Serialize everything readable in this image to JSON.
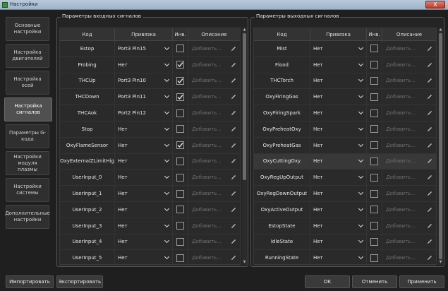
{
  "window": {
    "title": "Настройки",
    "close_label": "X"
  },
  "sidebar": {
    "items": [
      {
        "label": "Основные настройки",
        "active": false
      },
      {
        "label": "Настройка двигателей",
        "active": false
      },
      {
        "label": "Настройка осей",
        "active": false
      },
      {
        "label": "Настройка сигналов",
        "active": true
      },
      {
        "label": "Параметры G-кода",
        "active": false
      },
      {
        "label": "Настройки модуля плазмы",
        "active": false
      },
      {
        "label": "Настройки системы",
        "active": false
      },
      {
        "label": "Дополнительные настройки",
        "active": false
      }
    ]
  },
  "inputs": {
    "title": "Параметры входных сигналов",
    "headers": {
      "code": "Код",
      "binding": "Привязка",
      "inv": "Инв.",
      "desc": "Описание"
    },
    "rows": [
      {
        "code": "Estop",
        "binding": "Port3 Pin15",
        "inv": false,
        "desc": "Добавить..."
      },
      {
        "code": "Probing",
        "binding": "Нет",
        "inv": true,
        "desc": "Добавить..."
      },
      {
        "code": "THCUp",
        "binding": "Port3 Pin10",
        "inv": true,
        "desc": "Добавить..."
      },
      {
        "code": "THCDown",
        "binding": "Port3 Pin11",
        "inv": true,
        "desc": "Добавить..."
      },
      {
        "code": "THCAok",
        "binding": "Port2 Pin12",
        "inv": false,
        "desc": "Добавить..."
      },
      {
        "code": "Stop",
        "binding": "Нет",
        "inv": false,
        "desc": "Добавить..."
      },
      {
        "code": "OxyFlameSensor",
        "binding": "Нет",
        "inv": true,
        "desc": "Добавить..."
      },
      {
        "code": "OxyExternalZLimitHig",
        "binding": "Нет",
        "inv": false,
        "desc": "Добавить..."
      },
      {
        "code": "UserInput_0",
        "binding": "Нет",
        "inv": false,
        "desc": "Добавить..."
      },
      {
        "code": "UserInput_1",
        "binding": "Нет",
        "inv": false,
        "desc": "Добавить..."
      },
      {
        "code": "UserInput_2",
        "binding": "Нет",
        "inv": false,
        "desc": "Добавить..."
      },
      {
        "code": "UserInput_3",
        "binding": "Нет",
        "inv": false,
        "desc": "Добавить..."
      },
      {
        "code": "UserInput_4",
        "binding": "Нет",
        "inv": false,
        "desc": "Добавить..."
      },
      {
        "code": "UserInput_5",
        "binding": "Нет",
        "inv": false,
        "desc": "Добавить..."
      }
    ]
  },
  "outputs": {
    "title": "Параметры выходных сигналов",
    "headers": {
      "code": "Код",
      "binding": "Привязка",
      "inv": "Инв.",
      "desc": "Описание"
    },
    "rows": [
      {
        "code": "Mist",
        "binding": "Нет",
        "inv": false,
        "desc": "Добавить...",
        "selected": false
      },
      {
        "code": "Flood",
        "binding": "Нет",
        "inv": false,
        "desc": "Добавить...",
        "selected": false
      },
      {
        "code": "THCTorch",
        "binding": "Нет",
        "inv": false,
        "desc": "Добавить...",
        "selected": false
      },
      {
        "code": "OxyFiringGas",
        "binding": "Нет",
        "inv": false,
        "desc": "Добавить...",
        "selected": false
      },
      {
        "code": "OxyFiringSpark",
        "binding": "Нет",
        "inv": false,
        "desc": "Добавить...",
        "selected": false
      },
      {
        "code": "OxyPreheatOxy",
        "binding": "Нет",
        "inv": false,
        "desc": "Добавить...",
        "selected": false
      },
      {
        "code": "OxyPreheatGas",
        "binding": "Нет",
        "inv": false,
        "desc": "Добавить...",
        "selected": false
      },
      {
        "code": "OxyCuttingOxy",
        "binding": "Нет",
        "inv": false,
        "desc": "Добавить...",
        "selected": true
      },
      {
        "code": "OxyRegUpOutput",
        "binding": "Нет",
        "inv": false,
        "desc": "Добавить...",
        "selected": false
      },
      {
        "code": "OxyRegDownOutput",
        "binding": "Нет",
        "inv": false,
        "desc": "Добавить...",
        "selected": false
      },
      {
        "code": "OxyActiveOutput",
        "binding": "Нет",
        "inv": false,
        "desc": "Добавить...",
        "selected": false
      },
      {
        "code": "EstopState",
        "binding": "Нет",
        "inv": false,
        "desc": "Добавить...",
        "selected": false
      },
      {
        "code": "IdleState",
        "binding": "Нет",
        "inv": false,
        "desc": "Добавить...",
        "selected": false
      },
      {
        "code": "RunningState",
        "binding": "Нет",
        "inv": false,
        "desc": "Добавить...",
        "selected": false
      }
    ]
  },
  "footer": {
    "import_label": "Импортировать",
    "export_label": "Экспортировать",
    "ok_label": "ОК",
    "cancel_label": "Отменить",
    "apply_label": "Применить"
  },
  "colors": {
    "background": "#1f1f1f",
    "panel": "#242424",
    "active_tab": "#505050",
    "check": "#e6e6e6"
  }
}
